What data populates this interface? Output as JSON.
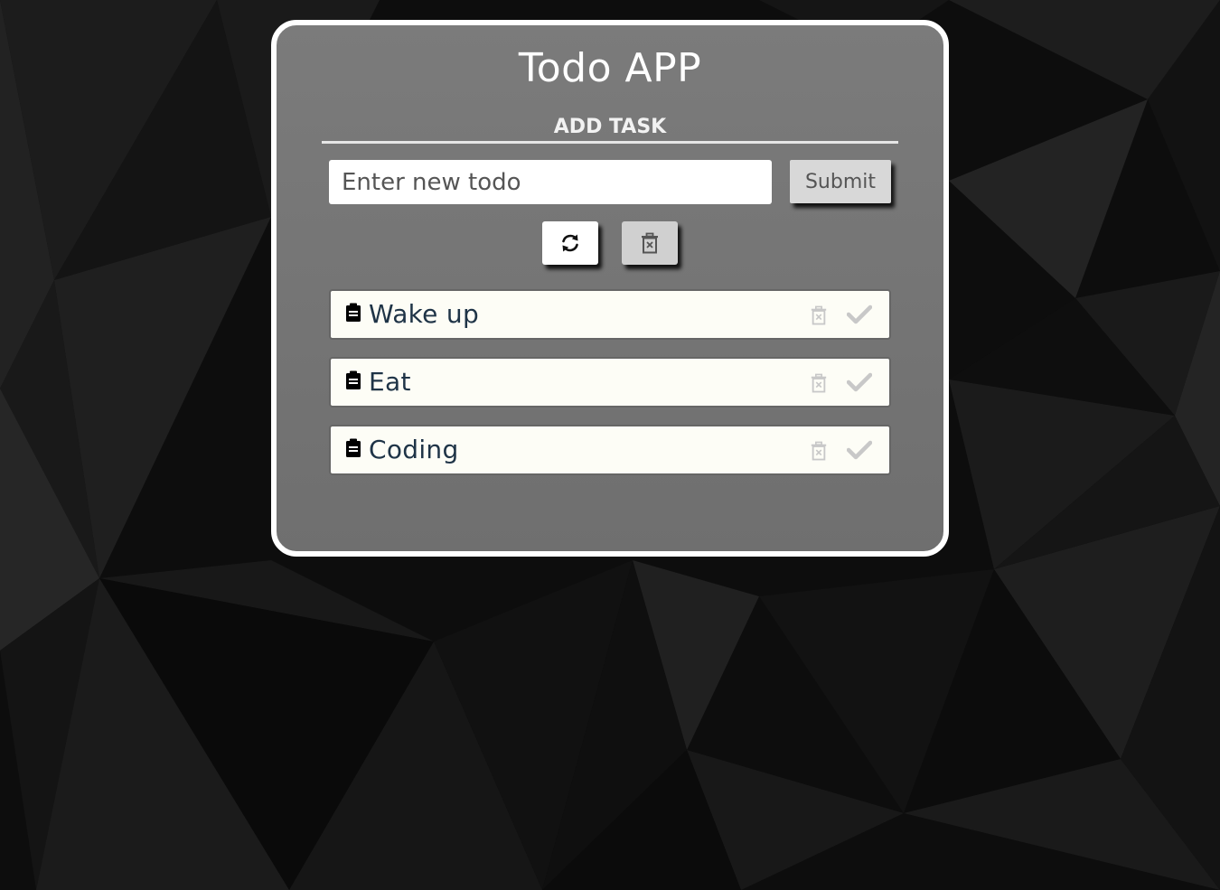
{
  "app": {
    "title": "Todo APP",
    "subtitle": "ADD TASK"
  },
  "form": {
    "input_placeholder": "Enter new todo",
    "input_value": "",
    "submit_label": "Submit"
  },
  "actions": {
    "refresh_icon": "refresh-icon",
    "clear_icon": "trash-icon"
  },
  "todos": [
    {
      "text": "Wake up",
      "icon": "clipboard-icon"
    },
    {
      "text": "Eat",
      "icon": "clipboard-icon"
    },
    {
      "text": "Coding",
      "icon": "clipboard-icon"
    }
  ],
  "colors": {
    "card_background": "#757575",
    "card_border": "#ffffff",
    "item_background": "#fdfdf6",
    "item_text": "#1f3447",
    "muted_icon": "#c8c8c8"
  }
}
